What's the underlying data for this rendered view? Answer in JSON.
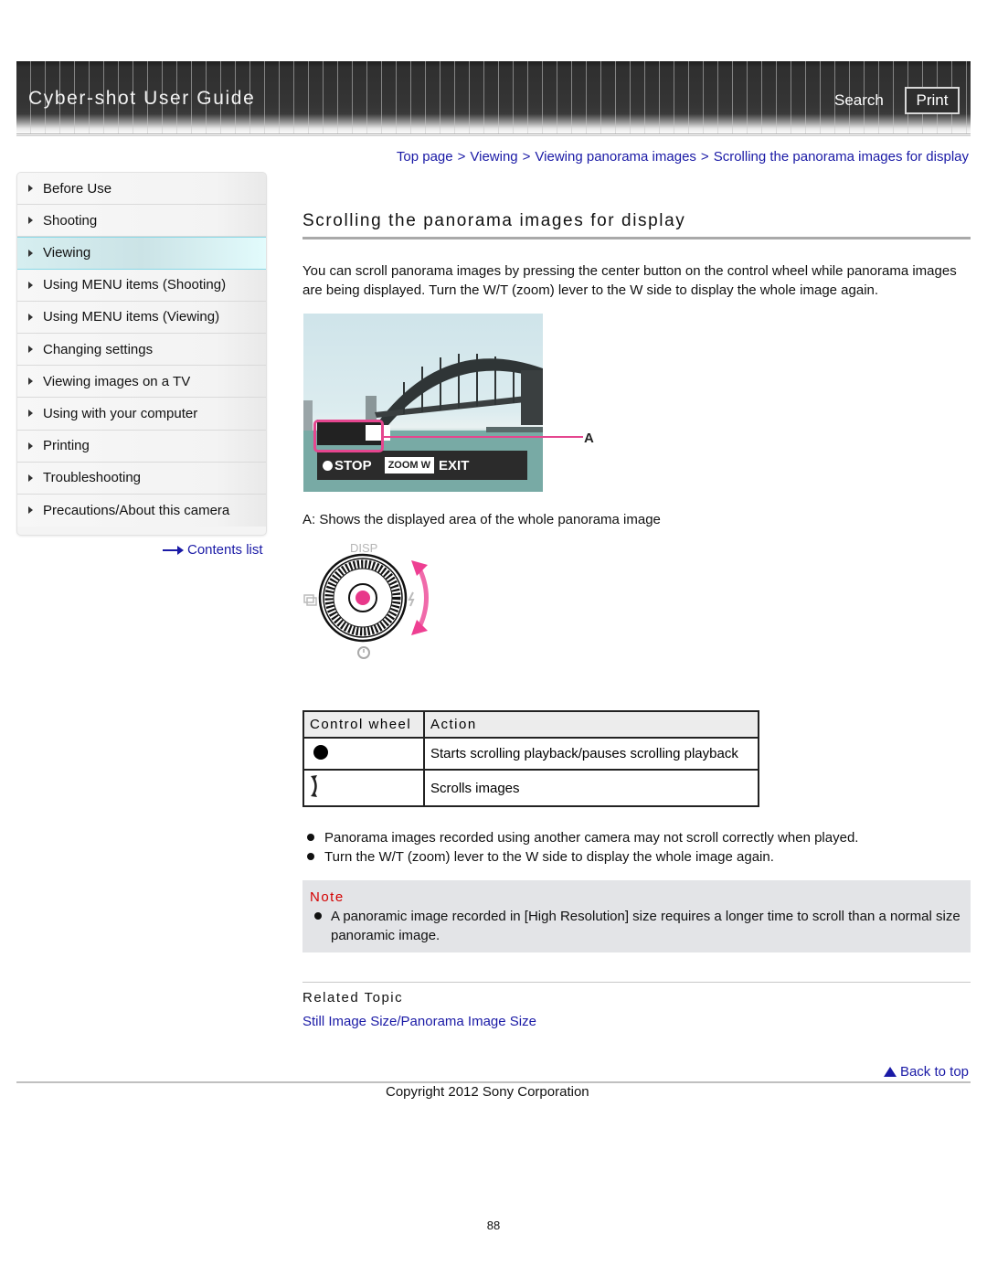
{
  "header": {
    "app_title": "Cyber-shot User Guide",
    "search_label": "Search",
    "print_label": "Print"
  },
  "sidebar": {
    "items": [
      {
        "label": "Before Use",
        "active": false
      },
      {
        "label": "Shooting",
        "active": false
      },
      {
        "label": "Viewing",
        "active": true
      },
      {
        "label": "Using MENU items (Shooting)",
        "active": false
      },
      {
        "label": "Using MENU items (Viewing)",
        "active": false
      },
      {
        "label": "Changing settings",
        "active": false
      },
      {
        "label": "Viewing images on a TV",
        "active": false
      },
      {
        "label": "Using with your computer",
        "active": false
      },
      {
        "label": "Printing",
        "active": false
      },
      {
        "label": "Troubleshooting",
        "active": false
      },
      {
        "label": "Precautions/About this camera",
        "active": false
      }
    ],
    "contents_link": "Contents list"
  },
  "breadcrumb": {
    "items": [
      "Top page",
      "Viewing",
      "Viewing panorama images",
      "Scrolling the panorama images for display"
    ],
    "separator": ">"
  },
  "main": {
    "title": "Scrolling the panorama images for display",
    "intro": "You can scroll panorama images by pressing the center button on the control wheel while panorama images are being displayed. Turn the W/T (zoom) lever to the W side to display the whole image again.",
    "figure": {
      "screen_labels": {
        "stop": "STOP",
        "zoom_w": "ZOOM W",
        "exit": "EXIT"
      },
      "callout": "A",
      "caption": "A: Shows the displayed area of the whole panorama image"
    },
    "wheel_figure": {
      "disp_label": "DISP"
    },
    "table": {
      "headers": [
        "Control wheel",
        "Action"
      ],
      "rows": [
        {
          "icon": "center-button-icon",
          "action": "Starts scrolling playback/pauses scrolling playback"
        },
        {
          "icon": "rotate-wheel-icon",
          "action": "Scrolls images"
        }
      ]
    },
    "bullets": [
      "Panorama images recorded using another camera may not scroll correctly when played.",
      "Turn the W/T (zoom) lever to the W side to display the whole image again."
    ],
    "note": {
      "title": "Note",
      "items": [
        "A panoramic image recorded in [High Resolution] size requires a longer time to scroll than a normal size panoramic image."
      ]
    },
    "related": {
      "title": "Related Topic",
      "links": [
        "Still Image Size/Panorama Image Size"
      ]
    }
  },
  "footer": {
    "back_to_top": "Back to top",
    "copyright": "Copyright 2012 Sony Corporation",
    "page_number": "88"
  },
  "colors": {
    "link": "#1a1aa6",
    "note_title": "#d40000",
    "accent_pink": "#e5468f",
    "active_nav": "#d6eef0"
  }
}
